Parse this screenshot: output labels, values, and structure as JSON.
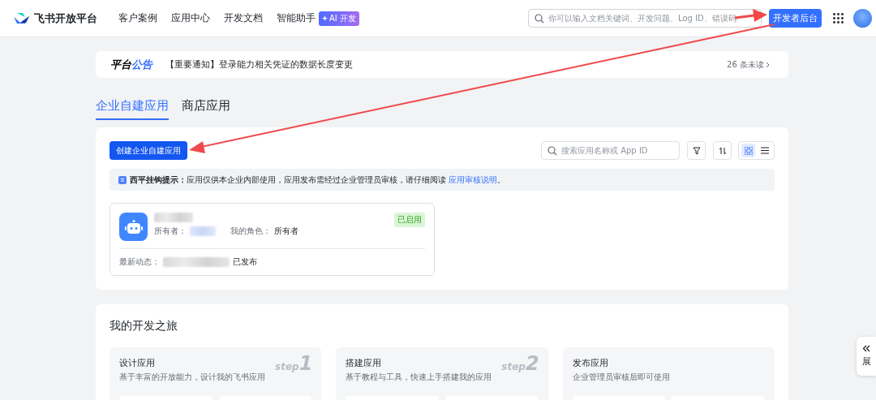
{
  "header": {
    "brand": "飞书开放平台",
    "nav": [
      "客户案例",
      "应用中心",
      "开发文档",
      "智能助手"
    ],
    "ai_badge": "AI 开发",
    "search": {
      "placeholder": "你可以输入文档关键词、开发问题、Log ID、错误码"
    },
    "console_button": "开发者后台"
  },
  "notice": {
    "label_a": "平台",
    "label_b": "公告",
    "text": "【重要通知】登录能力相关凭证的数据长度变更",
    "unread": "26 条未读"
  },
  "tabs": [
    {
      "label": "企业自建应用",
      "selected": true
    },
    {
      "label": "商店应用",
      "selected": false
    }
  ],
  "toolbar": {
    "create_button": "创建企业自建应用",
    "search": {
      "placeholder": "搜索应用名称或 App ID"
    },
    "views": [
      {
        "kind": "grid",
        "selected": true
      },
      {
        "kind": "list",
        "selected": false
      }
    ]
  },
  "hint": {
    "text": "**西平挂钩提示：**应用仅供本企业内部使用，应用发布需经过企业管理员审核，请仔细阅读 ",
    "link": "应用审核说明",
    "end": "。"
  },
  "apps": [
    {
      "owner_label": "所有者：",
      "role_label": "我的角色：",
      "role": "所有者",
      "status": "已启用",
      "activity_label": "最新动态：",
      "activity": "已发布"
    }
  ],
  "journey": {
    "title": "我的开发之旅",
    "steps": [
      {
        "title": "设计应用",
        "desc": "基于丰富的开放能力，设计我的飞书应用",
        "step": "step",
        "number": "1"
      },
      {
        "title": "搭建应用",
        "desc": "基于教程与工具，快速上手搭建我的应用",
        "step": "step",
        "number": "2"
      },
      {
        "title": "发布应用",
        "desc": "企业管理员审核后即可使用"
      }
    ]
  },
  "side_tab": "展"
}
